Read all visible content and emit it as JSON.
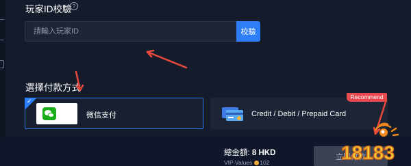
{
  "player_id_section": {
    "title": "玩家ID校驗",
    "help_icon": "question-circle-icon"
  },
  "player_id_input": {
    "placeholder": "請輸入玩家ID",
    "value": ""
  },
  "verify_button": {
    "label": "校驗"
  },
  "payment_section": {
    "title": "選擇付款方式"
  },
  "payment_methods": [
    {
      "label": "微信支付",
      "icon": "wechat-icon",
      "selected": true
    },
    {
      "label": "Credit / Debit / Prepaid Card",
      "icon": "credit-card-icon",
      "badge": "Recommend",
      "selected": false
    }
  ],
  "footer": {
    "total_label": "總金額:",
    "total_value": "8 HKD",
    "vip_label": "VIP Values",
    "vip_value": "102",
    "buy_button_label": "立即付款"
  },
  "watermark": {
    "text": "18183"
  },
  "colors": {
    "background": "#141b2b",
    "accent": "#2d7ef7",
    "recommend": "#e8494f",
    "arrow": "#e8493a"
  }
}
